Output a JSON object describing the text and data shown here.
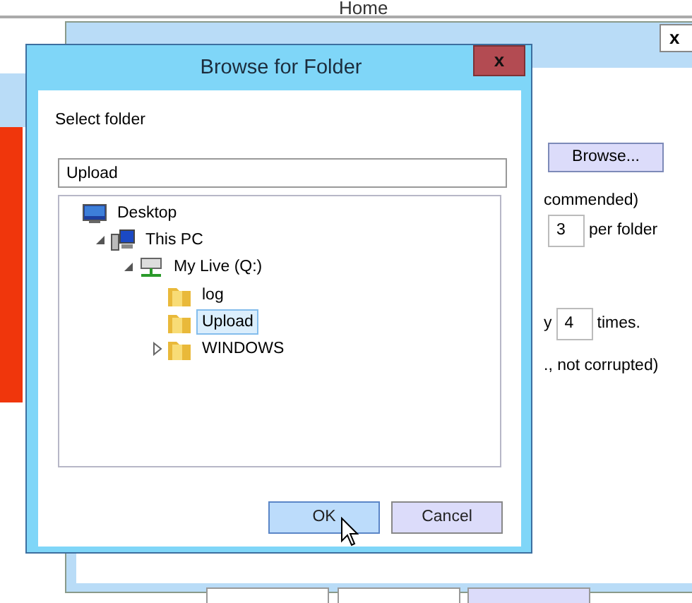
{
  "page_header": {
    "title": "Home"
  },
  "options_dialog": {
    "close": "x",
    "browse_button": "Browse...",
    "lines": [
      {
        "kind": "text",
        "parts": [
          "commended)"
        ]
      },
      {
        "kind": "field",
        "value": "3",
        "after": "per folder"
      },
      {
        "kind": "retry",
        "before": "y",
        "value": "4",
        "after": "times."
      },
      {
        "kind": "text",
        "parts": [
          "., not corrupted)"
        ]
      }
    ]
  },
  "browse_dialog": {
    "title": "Browse for Folder",
    "close": "x",
    "prompt": "Select folder",
    "folder_field": {
      "value": "Upload"
    },
    "tree": [
      {
        "label": "Desktop",
        "kind": "desktop",
        "selected": false,
        "children": [
          {
            "label": "This PC",
            "kind": "computer",
            "expanded": true,
            "selected": false,
            "children": [
              {
                "label": "My Live (Q:)",
                "kind": "drive",
                "expanded": true,
                "selected": false,
                "children": [
                  {
                    "label": "log",
                    "kind": "folder",
                    "selected": false
                  },
                  {
                    "label": "Upload",
                    "kind": "folder",
                    "selected": true
                  },
                  {
                    "label": "WINDOWS",
                    "kind": "folder",
                    "expanded": false,
                    "selected": false
                  }
                ]
              }
            ]
          }
        ]
      }
    ],
    "buttons": [
      {
        "label": "OK",
        "kind": "default"
      },
      {
        "label": "Cancel",
        "kind": "normal"
      }
    ]
  }
}
